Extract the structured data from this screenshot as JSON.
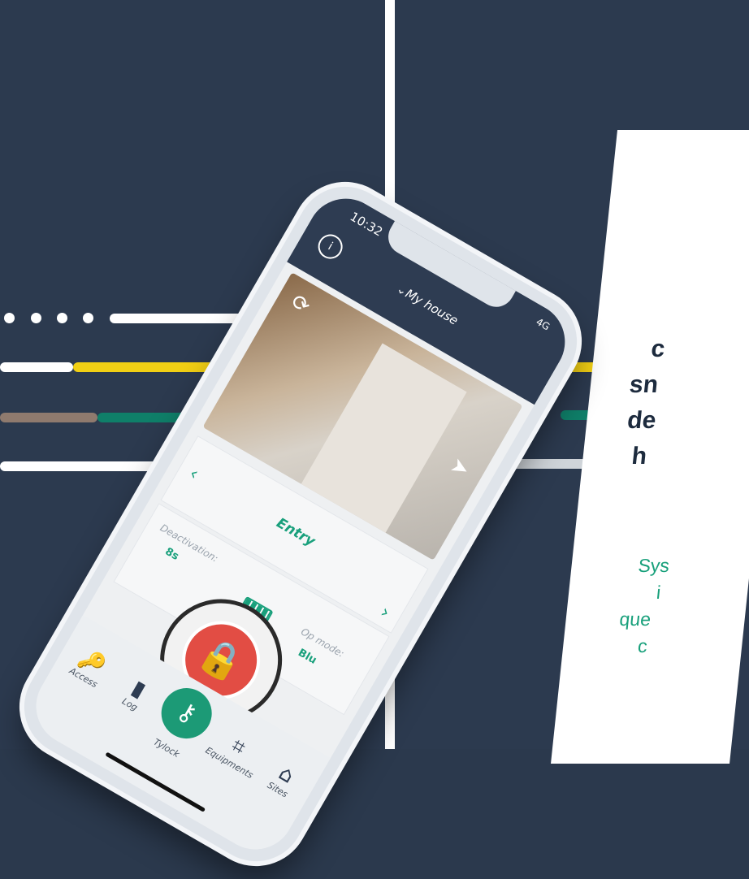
{
  "colors": {
    "navy": "#2c3a4f",
    "green": "#19a07c",
    "yellow": "#f1cf14",
    "brown": "#8f7a6e",
    "red": "#e24d44"
  },
  "phone": {
    "time": "10:32",
    "status": "4G",
    "site": "My house",
    "lock_name": "Entry",
    "deactivation_label": "Deactivation:",
    "deactivation_value": "8s",
    "open_mode_label": "Op  mode:",
    "open_mode_value": "Blu",
    "icons": [
      "info-icon",
      "refresh-icon",
      "send-icon",
      "battery-icon",
      "lock-icon"
    ],
    "tabs": [
      {
        "label": "Access",
        "icon": "key-icon",
        "glyph": "🔑"
      },
      {
        "label": "Log",
        "icon": "door-icon",
        "glyph": "▮"
      },
      {
        "label": "Tylock",
        "icon": "keys-icon",
        "glyph": "⚷"
      },
      {
        "label": "Equipments",
        "icon": "equipment-icon",
        "glyph": "⌗"
      },
      {
        "label": "Sites",
        "icon": "house-icon",
        "glyph": "⌂"
      }
    ]
  },
  "promo": {
    "line1": "c",
    "line2": "sn",
    "line3": "de",
    "line4": "h",
    "body1": "Sys",
    "body2": "i",
    "body3": "que",
    "body4": "c"
  }
}
